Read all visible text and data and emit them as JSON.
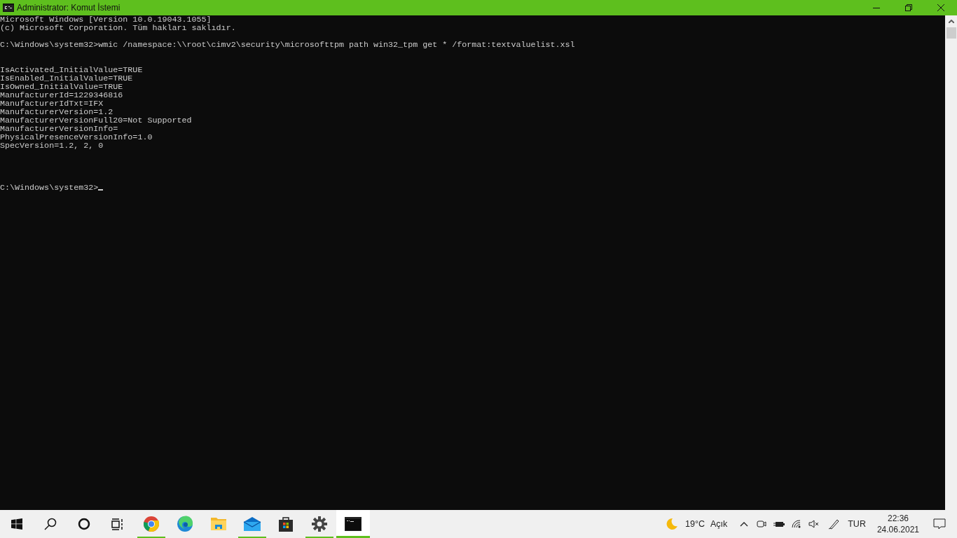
{
  "window": {
    "title": "Administrator: Komut İstemi"
  },
  "console": {
    "lines": [
      {
        "kind": "text",
        "text": "Microsoft Windows [Version 10.0.19043.1055]"
      },
      {
        "kind": "text",
        "text": "(c) Microsoft Corporation. Tüm hakları saklıdır."
      },
      {
        "kind": "blank"
      },
      {
        "kind": "text",
        "text": "C:\\Windows\\system32>wmic /namespace:\\\\root\\cimv2\\security\\microsofttpm path win32_tpm get * /format:textvaluelist.xsl"
      },
      {
        "kind": "blank"
      },
      {
        "kind": "blank"
      },
      {
        "kind": "text",
        "text": "IsActivated_InitialValue=TRUE"
      },
      {
        "kind": "text",
        "text": "IsEnabled_InitialValue=TRUE"
      },
      {
        "kind": "text",
        "text": "IsOwned_InitialValue=TRUE"
      },
      {
        "kind": "text",
        "text": "ManufacturerId=1229346816"
      },
      {
        "kind": "text",
        "text": "ManufacturerIdTxt=IFX"
      },
      {
        "kind": "text",
        "text": "ManufacturerVersion=1.2"
      },
      {
        "kind": "text",
        "text": "ManufacturerVersionFull20=Not Supported"
      },
      {
        "kind": "text",
        "text": "ManufacturerVersionInfo="
      },
      {
        "kind": "text",
        "text": "PhysicalPresenceVersionInfo=1.0"
      },
      {
        "kind": "text",
        "text": "SpecVersion=1.2, 2, 0"
      },
      {
        "kind": "blank"
      },
      {
        "kind": "blank"
      },
      {
        "kind": "blank"
      },
      {
        "kind": "blank"
      },
      {
        "kind": "prompt",
        "text": "C:\\Windows\\system32>"
      }
    ]
  },
  "taskbar": {
    "apps": [
      {
        "kind": "chrome",
        "running": true,
        "selected": false
      },
      {
        "kind": "edge",
        "running": false,
        "selected": false
      },
      {
        "kind": "explorer",
        "running": false,
        "selected": false
      },
      {
        "kind": "mail",
        "running": true,
        "selected": false
      },
      {
        "kind": "store",
        "running": false,
        "selected": false
      },
      {
        "kind": "settings",
        "running": true,
        "selected": false
      },
      {
        "kind": "terminal",
        "running": true,
        "selected": true
      }
    ],
    "weather": {
      "temperature": "19°C",
      "condition": "Açık"
    },
    "language": "TUR",
    "time": "22:36",
    "date": "24.06.2021"
  }
}
